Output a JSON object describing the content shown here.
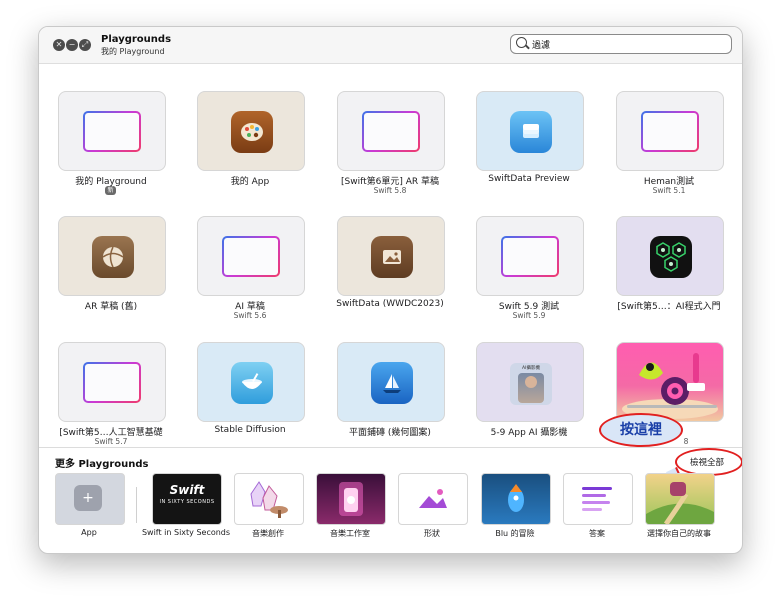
{
  "window": {
    "title": "Playgrounds",
    "subtitle": "我的 Playground"
  },
  "search": {
    "value": "過濾"
  },
  "playgrounds": [
    {
      "label": "我的 Playground",
      "badge": "新"
    },
    {
      "label": "我的 App"
    },
    {
      "label": "[Swift第6單元] AR 草稿",
      "sub": "Swift 5.8"
    },
    {
      "label": "SwiftData Preview"
    },
    {
      "label": "Heman測試",
      "sub": "Swift 5.1"
    },
    {
      "label": "AR 草稿 (舊)"
    },
    {
      "label": "AI 草稿",
      "sub": "Swift 5.6"
    },
    {
      "label": "SwiftData (WWDC2023)"
    },
    {
      "label": "Swift 5.9 測試",
      "sub": "Swift 5.9"
    },
    {
      "label": "[Swift第5…：AI程式入門"
    },
    {
      "label": "[Swift第5…人工智慧基礎",
      "sub": "Swift 5.7"
    },
    {
      "label": "Stable Diffusion"
    },
    {
      "label": "平面鋪磚 (幾何圖案)"
    },
    {
      "label": "5-9 App AI 攝影機"
    },
    {
      "label": "…鏡",
      "sub": "8"
    }
  ],
  "callout": "按這裡",
  "tile_inner_text": "AI攝影機",
  "more": {
    "title": "更多 Playgrounds",
    "view_all": "檢視全部"
  },
  "more_items": [
    {
      "label": "App"
    },
    {
      "label": "Swift in Sixty Seconds",
      "thumb_title": "Swift",
      "thumb_sub": "IN SIXTY SECONDS"
    },
    {
      "label": "音樂創作"
    },
    {
      "label": "音樂工作室"
    },
    {
      "label": "形狀"
    },
    {
      "label": "Blu 的冒險"
    },
    {
      "label": "答案"
    },
    {
      "label": "選擇你自己的故事"
    }
  ],
  "colors": {
    "accent": "#e12020",
    "callout_text": "#1a3fa8"
  }
}
